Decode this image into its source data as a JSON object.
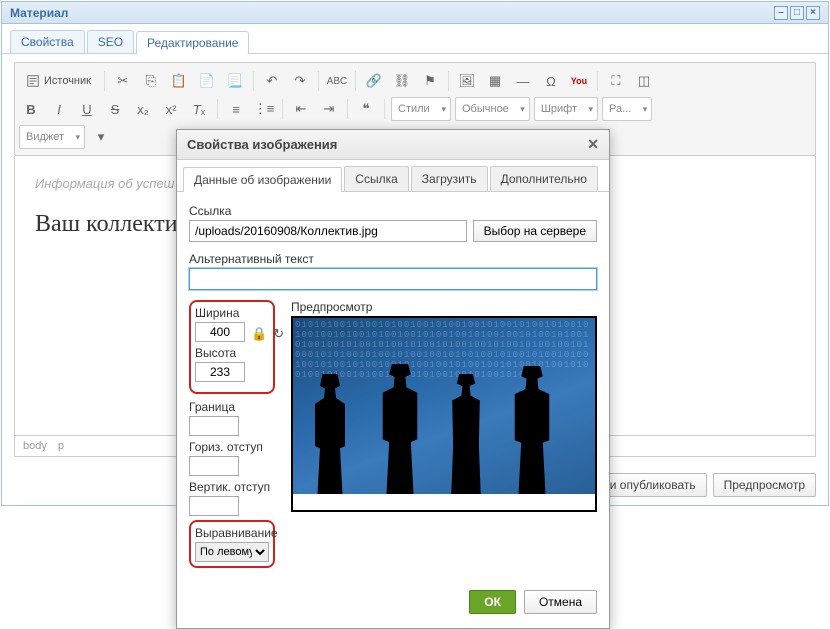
{
  "window": {
    "title": "Материал",
    "tabs": [
      "Свойства",
      "SEO",
      "Редактирование"
    ],
    "active_tab": 2
  },
  "toolbar": {
    "source": "Источник",
    "styles": "Стили",
    "format": "Обычное",
    "font": "Шрифт",
    "size": "Ра...",
    "widget": "Виджет"
  },
  "content": {
    "info_prefix": "Информация об ",
    "info_italic": "успеш",
    "heading": "Ваш коллектив"
  },
  "statusbar": {
    "path": [
      "body",
      "p"
    ]
  },
  "footer": {
    "save_publish": "нить и опубликовать",
    "preview": "Предпросмотр"
  },
  "dialog": {
    "title": "Свойства изображения",
    "tabs": [
      "Данные об изображении",
      "Ссылка",
      "Загрузить",
      "Дополнительно"
    ],
    "active_tab": 0,
    "url_label": "Ссылка",
    "url_value": "/uploads/20160908/Коллектив.jpg",
    "browse": "Выбор на сервере",
    "alt_label": "Альтернативный текст",
    "alt_value": "",
    "width_label": "Ширина",
    "width_value": "400",
    "height_label": "Высота",
    "height_value": "233",
    "border_label": "Граница",
    "border_value": "",
    "hspace_label": "Гориз. отступ",
    "hspace_value": "",
    "vspace_label": "Вертик. отступ",
    "vspace_value": "",
    "align_label": "Выравнивание",
    "align_value": "По левому",
    "preview_label": "Предпросмотр",
    "ok": "ОК",
    "cancel": "Отмена"
  }
}
